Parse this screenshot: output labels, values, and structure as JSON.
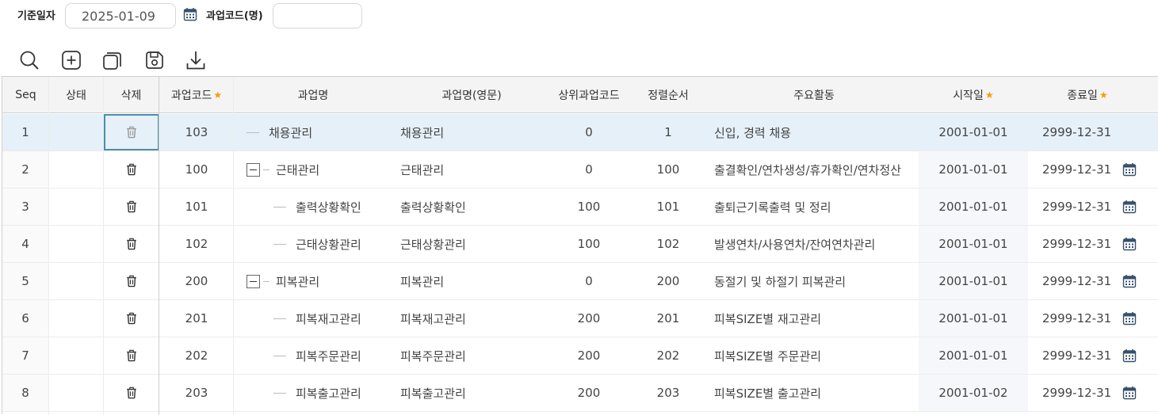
{
  "filter": {
    "date_label": "기준일자",
    "date_value": "2025-01-09",
    "code_label": "과업코드(명)",
    "code_value": ""
  },
  "toolbar": {
    "icons": [
      "search-icon",
      "add-icon",
      "copy-icon",
      "save-icon",
      "download-icon"
    ]
  },
  "grid": {
    "headers": {
      "seq": "Seq",
      "status": "상태",
      "delete": "삭제",
      "code": "과업코드",
      "name": "과업명",
      "name_en": "과업명(영문)",
      "parent": "상위과업코드",
      "order": "정렬순서",
      "activity": "주요활동",
      "start": "시작일",
      "end": "종료일"
    },
    "required_marker": "★",
    "rows": [
      {
        "seq": "1",
        "code": "103",
        "name": "채용관리",
        "name_en": "채용관리",
        "parent": "0",
        "order": "1",
        "activity": "신입, 경력 채용",
        "start": "2001-01-01",
        "end": "2999-12-31",
        "level": 0,
        "toggle": false,
        "selected": true
      },
      {
        "seq": "2",
        "code": "100",
        "name": "근태관리",
        "name_en": "근태관리",
        "parent": "0",
        "order": "100",
        "activity": "출결확인/연차생성/휴가확인/연차정산",
        "start": "2001-01-01",
        "end": "2999-12-31",
        "level": 0,
        "toggle": true,
        "selected": false
      },
      {
        "seq": "3",
        "code": "101",
        "name": "출력상황확인",
        "name_en": "출력상황확인",
        "parent": "100",
        "order": "101",
        "activity": "출퇴근기록출력 및 정리",
        "start": "2001-01-01",
        "end": "2999-12-31",
        "level": 1,
        "toggle": false,
        "selected": false
      },
      {
        "seq": "4",
        "code": "102",
        "name": "근태상황관리",
        "name_en": "근태상황관리",
        "parent": "100",
        "order": "102",
        "activity": "발생연차/사용연차/잔여연차관리",
        "start": "2001-01-01",
        "end": "2999-12-31",
        "level": 1,
        "toggle": false,
        "selected": false
      },
      {
        "seq": "5",
        "code": "200",
        "name": "피복관리",
        "name_en": "피복관리",
        "parent": "0",
        "order": "200",
        "activity": "동절기 및 하절기 피복관리",
        "start": "2001-01-01",
        "end": "2999-12-31",
        "level": 0,
        "toggle": true,
        "selected": false
      },
      {
        "seq": "6",
        "code": "201",
        "name": "피복재고관리",
        "name_en": "피복재고관리",
        "parent": "200",
        "order": "201",
        "activity": "피복SIZE별 재고관리",
        "start": "2001-01-01",
        "end": "2999-12-31",
        "level": 1,
        "toggle": false,
        "selected": false
      },
      {
        "seq": "7",
        "code": "202",
        "name": "피복주문관리",
        "name_en": "피복주문관리",
        "parent": "200",
        "order": "202",
        "activity": "피복SIZE별 주문관리",
        "start": "2001-01-01",
        "end": "2999-12-31",
        "level": 1,
        "toggle": false,
        "selected": false
      },
      {
        "seq": "8",
        "code": "203",
        "name": "피복출고관리",
        "name_en": "피복출고관리",
        "parent": "200",
        "order": "203",
        "activity": "피복SIZE별 출고관리",
        "start": "2001-01-02",
        "end": "2999-12-31",
        "level": 1,
        "toggle": false,
        "selected": false
      }
    ]
  }
}
